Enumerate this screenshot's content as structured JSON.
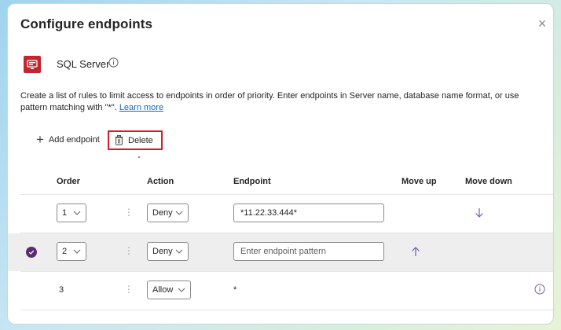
{
  "dialog": {
    "title": "Configure endpoints",
    "close_glyph": "×"
  },
  "connector": {
    "name": "SQL Server",
    "icon": "sql-server-icon",
    "icon_color": "#c4262e"
  },
  "description": {
    "text": "Create a list of rules to limit access to endpoints in order of priority. Enter endpoints in Server name, database name format, or use pattern matching with \"*\". ",
    "link": "Learn more"
  },
  "toolbar": {
    "add_label": "Add endpoint",
    "delete_label": "Delete",
    "highlight_color": "#d21f26"
  },
  "table": {
    "headers": {
      "order": "Order",
      "action": "Action",
      "endpoint": "Endpoint",
      "move_up": "Move up",
      "move_down": "Move down"
    },
    "rows": [
      {
        "order": "1",
        "action": "Deny",
        "endpoint": "*11.22.33.444*",
        "endpoint_placeholder": "",
        "selected": false
      },
      {
        "order": "2",
        "action": "Deny",
        "endpoint": "",
        "endpoint_placeholder": "Enter endpoint pattern",
        "selected": true
      },
      {
        "order": "3",
        "action": "Allow",
        "endpoint": "*",
        "endpoint_placeholder": "",
        "selected": false
      }
    ]
  },
  "colors": {
    "accent": "#5b2c6f",
    "link": "#0f6cbd",
    "arrow": "#7a5aa6"
  }
}
